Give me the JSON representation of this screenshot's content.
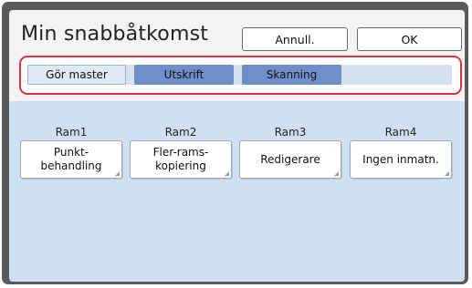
{
  "header": {
    "title": "Min snabbåtkomst",
    "cancel_label": "Annull.",
    "ok_label": "OK"
  },
  "tabs": [
    {
      "label": "Gör master"
    },
    {
      "label": "Utskrift"
    },
    {
      "label": "Skanning"
    }
  ],
  "frames": [
    {
      "label": "Ram1",
      "button": "Punkt-\nbehandling"
    },
    {
      "label": "Ram2",
      "button": "Fler-rams-\nkopiering"
    },
    {
      "label": "Ram3",
      "button": "Redigerare"
    },
    {
      "label": "Ram4",
      "button": "Ingen inmatn."
    }
  ],
  "colors": {
    "highlight_border": "#d9323a",
    "tab_active": "#dfe8f3",
    "tab_inactive": "#6f8fcb",
    "content_bg": "#cfe0f0"
  }
}
